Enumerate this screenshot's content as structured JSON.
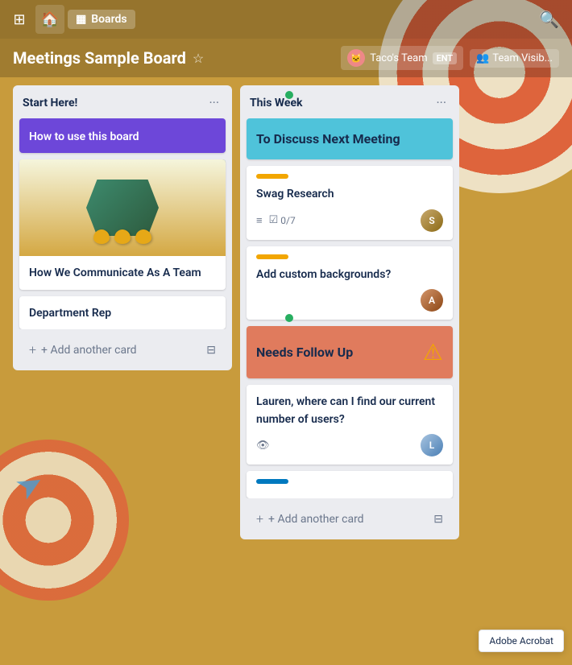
{
  "app": {
    "grid_icon": "⊞",
    "home_icon": "🏠",
    "boards_label": "Boards",
    "boards_icon": "▦",
    "search_icon": "🔍"
  },
  "board": {
    "title": "Meetings Sample Board",
    "star_icon": "☆",
    "team": {
      "avatar_text": "🐱",
      "name": "Taco's Team",
      "badge": "ENT"
    },
    "visibility_icon": "👥",
    "visibility_label": "Team Visib..."
  },
  "lists": [
    {
      "id": "start-here",
      "title": "Start Here!",
      "menu_icon": "···",
      "cards": [
        {
          "id": "how-to-use",
          "type": "purple",
          "title": "How to use this board"
        },
        {
          "id": "how-we-communicate",
          "type": "image",
          "title": "How We Communicate As A Team",
          "has_image": true
        },
        {
          "id": "department-rep",
          "type": "plain",
          "title": "Department Rep"
        }
      ],
      "add_card_label": "+ Add another card",
      "template_icon": "⊟"
    },
    {
      "id": "this-week",
      "title": "This Week",
      "menu_icon": "···",
      "cards": [
        {
          "id": "to-discuss",
          "type": "cyan",
          "title": "To Discuss Next Meeting"
        },
        {
          "id": "swag-research",
          "type": "labeled",
          "label_color": "yellow",
          "title": "Swag Research",
          "meta_description_icon": "≡",
          "meta_checklist_icon": "☑",
          "meta_checklist_text": "0/7",
          "has_avatar": true,
          "avatar_class": "avatar-1",
          "avatar_text": "S"
        },
        {
          "id": "add-custom-backgrounds",
          "type": "labeled",
          "label_color": "yellow",
          "title": "Add custom backgrounds?",
          "has_avatar": true,
          "avatar_class": "avatar-2",
          "avatar_text": "A"
        },
        {
          "id": "needs-follow-up",
          "type": "salmon",
          "title": "Needs Follow Up",
          "warning_icon": "⚠"
        },
        {
          "id": "lauren-question",
          "type": "question",
          "title": "Lauren, where can I find our current number of users?",
          "meta_eye_icon": "👁",
          "has_avatar": true,
          "avatar_class": "avatar-3",
          "avatar_text": "L"
        },
        {
          "id": "blue-label-card",
          "type": "blue-label",
          "label_color": "blue"
        }
      ],
      "add_card_label": "+ Add another card",
      "template_icon": "⊟"
    }
  ],
  "tooltip": {
    "text": "Adobe Acrobat"
  }
}
